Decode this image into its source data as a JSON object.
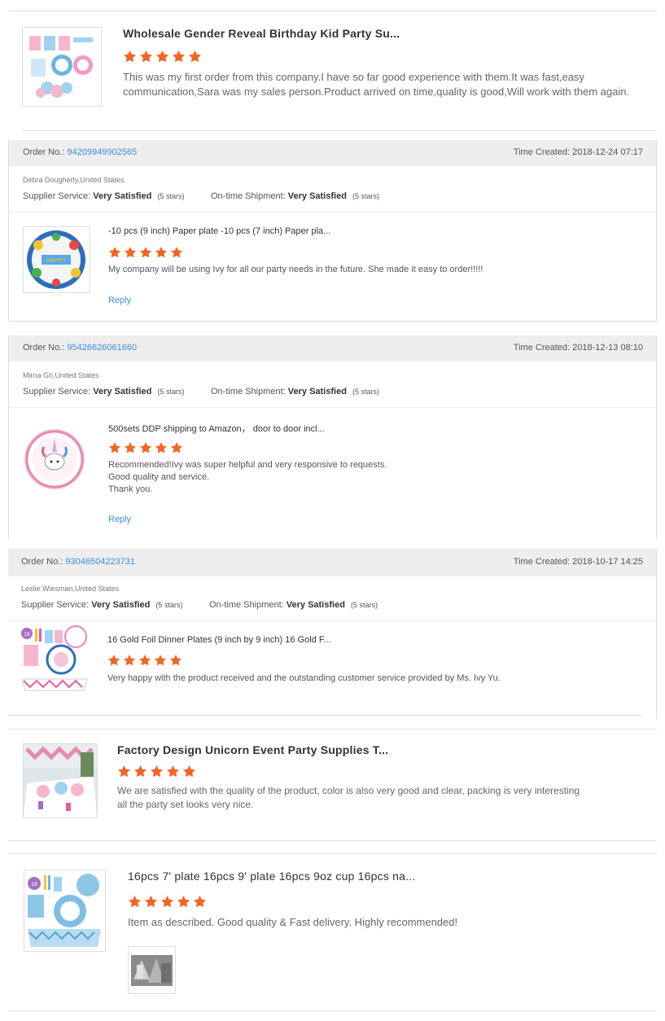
{
  "colors": {
    "star": "#f26522",
    "link": "#3a8ee6"
  },
  "review1": {
    "title": "Wholesale Gender Reveal Birthday Kid Party Su...",
    "text": "This was my first order from this company.I have so far good experience with them.It was fast,easy communication,Sara was my sales person.Product arrived on time,quality is good,Will work with them again."
  },
  "order1": {
    "order_label": "Order No.:",
    "order_no": "94209949902565",
    "time_label": "Time Created:",
    "time": "2018-12-24 07:17",
    "buyer": "Debra Dougherty,United States",
    "supplier_label": "Supplier Service:",
    "supplier_value": "Very Satisfied",
    "supplier_stars": "(5 stars)",
    "shipment_label": "On-time Shipment:",
    "shipment_value": "Very Satisfied",
    "shipment_stars": "(5 stars)",
    "product": "-10 pcs (9 inch) Paper plate -10 pcs (7 inch) Paper pla...",
    "text": "My company will be using Ivy for all our party needs in the future. She made it easy to order!!!!!",
    "reply": "Reply"
  },
  "order2": {
    "order_label": "Order No.:",
    "order_no": "95426626061660",
    "time_label": "Time Created:",
    "time": "2018-12-13 08:10",
    "buyer": "Mirna Gh,United States",
    "supplier_label": "Supplier Service:",
    "supplier_value": "Very Satisfied",
    "supplier_stars": "(5 stars)",
    "shipment_label": "On-time Shipment:",
    "shipment_value": "Very Satisfied",
    "shipment_stars": "(5 stars)",
    "product": "500sets DDP shipping to Amazon， door to door incl...",
    "text_lines": [
      "Recommended!Ivy was super helpful and very responsive to requests.",
      "Good quality and service.",
      "Thank you."
    ],
    "reply": "Reply"
  },
  "order3": {
    "order_label": "Order No.:",
    "order_no": "93046504223731",
    "time_label": "Time Created:",
    "time": "2018-10-17 14:25",
    "buyer": "Leslie Wiesman,United States",
    "supplier_label": "Supplier Service:",
    "supplier_value": "Very Satisfied",
    "supplier_stars": "(5 stars)",
    "shipment_label": "On-time Shipment:",
    "shipment_value": "Very Satisfied",
    "shipment_stars": "(5 stars)",
    "product": "16 Gold Foil Dinner Plates (9 inch by 9 inch) 16 Gold F...",
    "text": "Very happy with the product received and the outstanding customer service provided by Ms. Ivy Yu."
  },
  "review2": {
    "title": "Factory Design Unicorn Event Party Supplies T...",
    "text_lines": [
      "We are satisfied with the quality of the product, color is also very good and clear, packing is very interesting",
      "all the party set looks very nice."
    ]
  },
  "review3": {
    "title": "16pcs 7' plate 16pcs 9' plate 16pcs 9oz cup 16pcs na...",
    "text": "Item as described. Good quality & Fast delivery. Highly recommended!"
  },
  "rating": 5
}
